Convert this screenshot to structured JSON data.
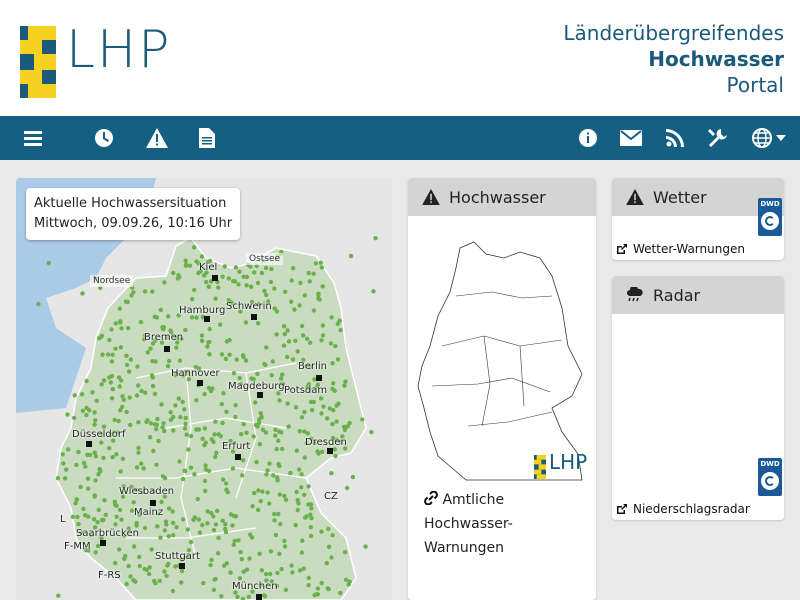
{
  "header": {
    "logo_text": "LHP",
    "title_line1": "Länderübergreifendes",
    "title_line2": "Hochwasser",
    "title_line3": "Portal"
  },
  "nav": {
    "left_icons": [
      "menu-icon",
      "clock-icon",
      "warning-icon",
      "document-icon"
    ],
    "right_icons": [
      "info-icon",
      "envelope-icon",
      "rss-icon",
      "tools-icon",
      "globe-icon"
    ]
  },
  "map": {
    "info_title": "Aktuelle Hochwassersituation",
    "info_date": "Mittwoch, 09.09.26, 10:16 Uhr",
    "seas": [
      "Nordsee",
      "Ostsee"
    ],
    "cities": [
      "Kiel",
      "Hamburg",
      "Schwerin",
      "Bremen",
      "Berlin",
      "Hannover",
      "Magdeburg",
      "Potsdam",
      "Düsseldorf",
      "Erfurt",
      "Dresden",
      "Wiesbaden",
      "Mainz",
      "Saarbrücken",
      "Stuttgart",
      "München"
    ],
    "borders": [
      "CZ",
      "L",
      "F-MM",
      "F-RS"
    ]
  },
  "hochwasser": {
    "title": "Hochwasser",
    "link": "Amtliche Hochwasser-Warnungen",
    "logo_text": "LHP"
  },
  "wetter": {
    "title": "Wetter",
    "link": "Wetter-Warnungen",
    "badge": "DWD"
  },
  "radar": {
    "title": "Radar",
    "link": "Niederschlagsradar",
    "badge": "DWD"
  },
  "colors": {
    "brand_blue": "#155f82",
    "brand_yellow": "#f4d21f",
    "map_water": "#aacbe8",
    "map_land": "#c9dcc0",
    "gauge_green": "#6ab04c"
  }
}
